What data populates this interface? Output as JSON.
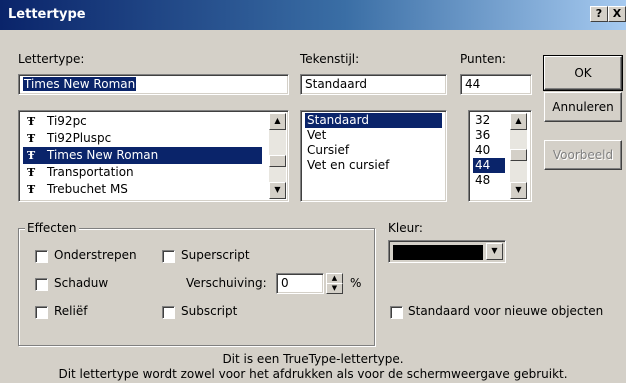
{
  "window": {
    "title": "Lettertype",
    "help_label": "?",
    "close_label": "X"
  },
  "font": {
    "label": "Lettertype:",
    "value": "Times New Roman",
    "items": [
      {
        "icon": "truetype-icon",
        "label": "Ti92pc"
      },
      {
        "icon": "truetype-icon",
        "label": "Ti92Pluspc"
      },
      {
        "icon": "truetype-icon",
        "label": "Times New Roman",
        "selected": true
      },
      {
        "icon": "truetype-icon",
        "label": "Transportation"
      },
      {
        "icon": "truetype-icon",
        "label": "Trebuchet MS"
      }
    ]
  },
  "style": {
    "label": "Tekenstijl:",
    "value": "Standaard",
    "items": [
      "Standaard",
      "Vet",
      "Cursief",
      "Vet en cursief"
    ]
  },
  "size": {
    "label": "Punten:",
    "value": "44",
    "items": [
      "32",
      "36",
      "40",
      "44",
      "48"
    ]
  },
  "buttons": {
    "ok": "OK",
    "cancel": "Annuleren",
    "preview": "Voorbeeld"
  },
  "effects": {
    "label": "Effecten",
    "underline": "Onderstrepen",
    "superscript": "Superscript",
    "shadow": "Schaduw",
    "offset_label": "Verschuiving:",
    "offset_value": "0",
    "offset_unit": "%",
    "emboss": "Reliëf",
    "subscript": "Subscript"
  },
  "color": {
    "label": "Kleur:",
    "value": "#000000"
  },
  "default_checkbox": "Standaard voor nieuwe objecten",
  "info": {
    "line1": "Dit is een TrueType-lettertype.",
    "line2": "Dit lettertype wordt zowel voor het afdrukken als voor de schermweergave gebruikt."
  }
}
